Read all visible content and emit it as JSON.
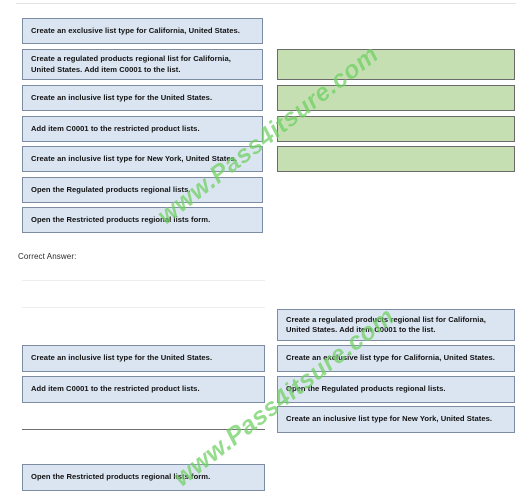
{
  "page": {
    "correct_answer_label": "Correct Answer:",
    "watermark_text": "www.Pass4itsure.com",
    "colors": {
      "tile_fill": "#dbe5f1",
      "tile_border": "#7b8ca3",
      "slot_fill": "#c5dfb3",
      "slot_border": "#6b6b6b",
      "watermark": "#6fcf62",
      "rule_light": "#e3e3e3",
      "rule_dark": "#6f6f6f"
    }
  },
  "question": {
    "actions": [
      {
        "label": "Create an exclusive list type for California, United States."
      },
      {
        "label": "Create a regulated products regional list for California, United States. Add item C0001 to the list."
      },
      {
        "label": "Create an inclusive list type for the United States."
      },
      {
        "label": "Add item C0001 to the restricted product lists."
      },
      {
        "label": "Create an inclusive list type for New York, United States."
      },
      {
        "label": "Open the Regulated products regional lists."
      },
      {
        "label": "Open the Restricted products regional lists form."
      }
    ],
    "answer_slots": [
      {
        "label": ""
      },
      {
        "label": ""
      },
      {
        "label": ""
      },
      {
        "label": ""
      }
    ]
  },
  "answer": {
    "left_column": [
      {
        "label": "Create an inclusive list type for the United States."
      },
      {
        "label": "Add item C0001 to the restricted product lists."
      },
      {
        "label": "Open the Restricted products regional lists form."
      }
    ],
    "right_column": [
      {
        "label": "Create a regulated products regional list for California, United States. Add item C0001 to the list."
      },
      {
        "label": "Create an exclusive list type for California, United States."
      },
      {
        "label": "Open the Regulated products regional lists."
      },
      {
        "label": "Create an inclusive list type for New York, United States."
      }
    ]
  }
}
